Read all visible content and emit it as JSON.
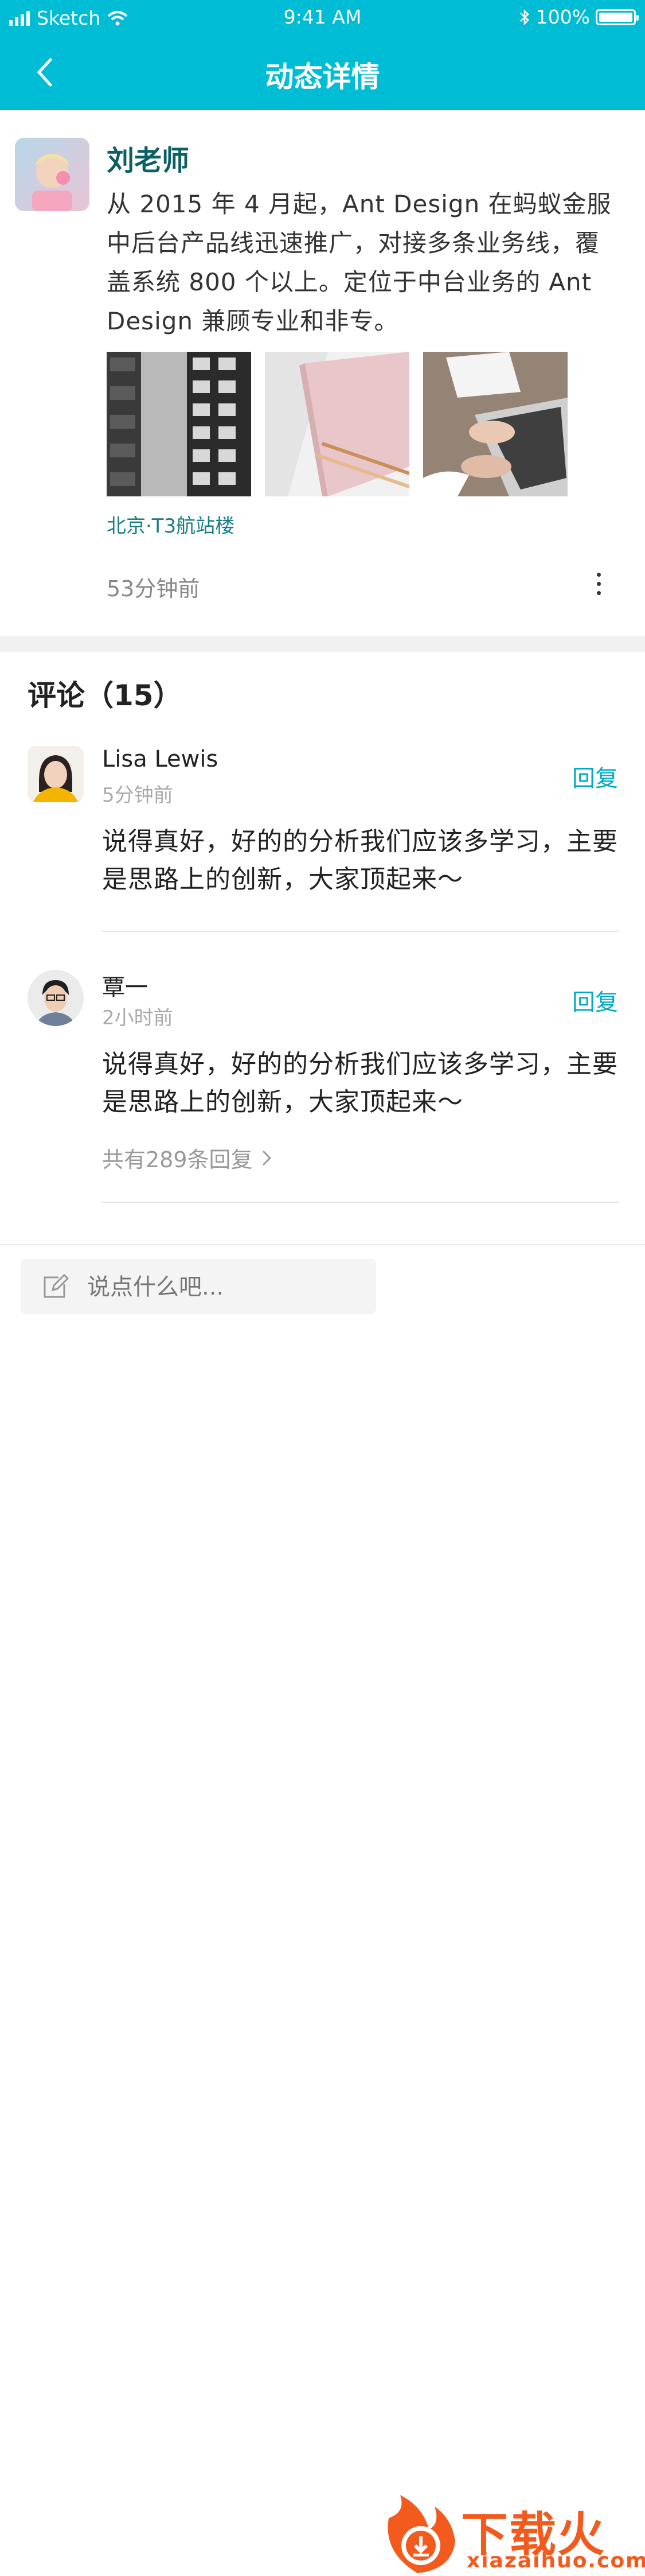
{
  "status_bar": {
    "carrier": "Sketch",
    "time": "9:41 AM",
    "battery": "100%"
  },
  "nav": {
    "title": "动态详情"
  },
  "post": {
    "author": "刘老师",
    "content": "从 2015 年 4 月起，Ant Design 在蚂蚁金服中后台产品线迅速推广，对接多条业务线，覆盖系统 800 个以上。定位于中台业务的 Ant Design 兼顾专业和非专。",
    "location": "北京·T3航站楼",
    "time": "53分钟前"
  },
  "comments": {
    "title": "评论（15）",
    "items": [
      {
        "name": "Lisa Lewis",
        "time": "5分钟前",
        "reply_label": "回复",
        "text": "说得真好，好的的分析我们应该多学习，主要是思路上的创新，大家顶起来～"
      },
      {
        "name": "覃一",
        "time": "2小时前",
        "reply_label": "回复",
        "text": "说得真好，好的的分析我们应该多学习，主要是思路上的创新，大家顶起来～",
        "sub_replies": "共有289条回复"
      }
    ]
  },
  "input": {
    "placeholder": "说点什么吧..."
  },
  "watermark": {
    "brand": "下载火",
    "url": "xiazaihuo.com"
  },
  "colors": {
    "primary": "#00bcd4",
    "accent_text": "#00a9c7",
    "author_name": "#0b5f66",
    "watermark": "#f35a1e"
  }
}
